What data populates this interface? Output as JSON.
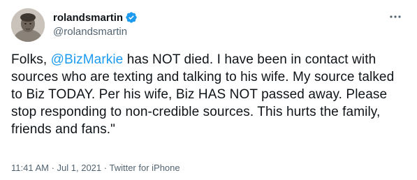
{
  "user": {
    "display_name": "rolandsmartin",
    "handle": "@rolandsmartin",
    "verified": true
  },
  "tweet": {
    "text_before_mention": "Folks, ",
    "mention": "@BizMarkie",
    "text_after_mention": " has NOT died. I have been in contact with sources who are texting and talking to his wife. My source talked to Biz TODAY. Per his wife, Biz HAS NOT passed away. Please stop responding to non-credible sources. This hurts the family, friends and fans.\""
  },
  "meta": {
    "time": "11:41 AM",
    "separator": " · ",
    "date": "Jul 1, 2021",
    "source": "Twitter for iPhone"
  },
  "icons": {
    "verified": "verified-badge-icon",
    "more": "more-options-icon"
  },
  "colors": {
    "accent": "#1d9bf0",
    "text": "#0f1419",
    "secondary": "#536471"
  }
}
